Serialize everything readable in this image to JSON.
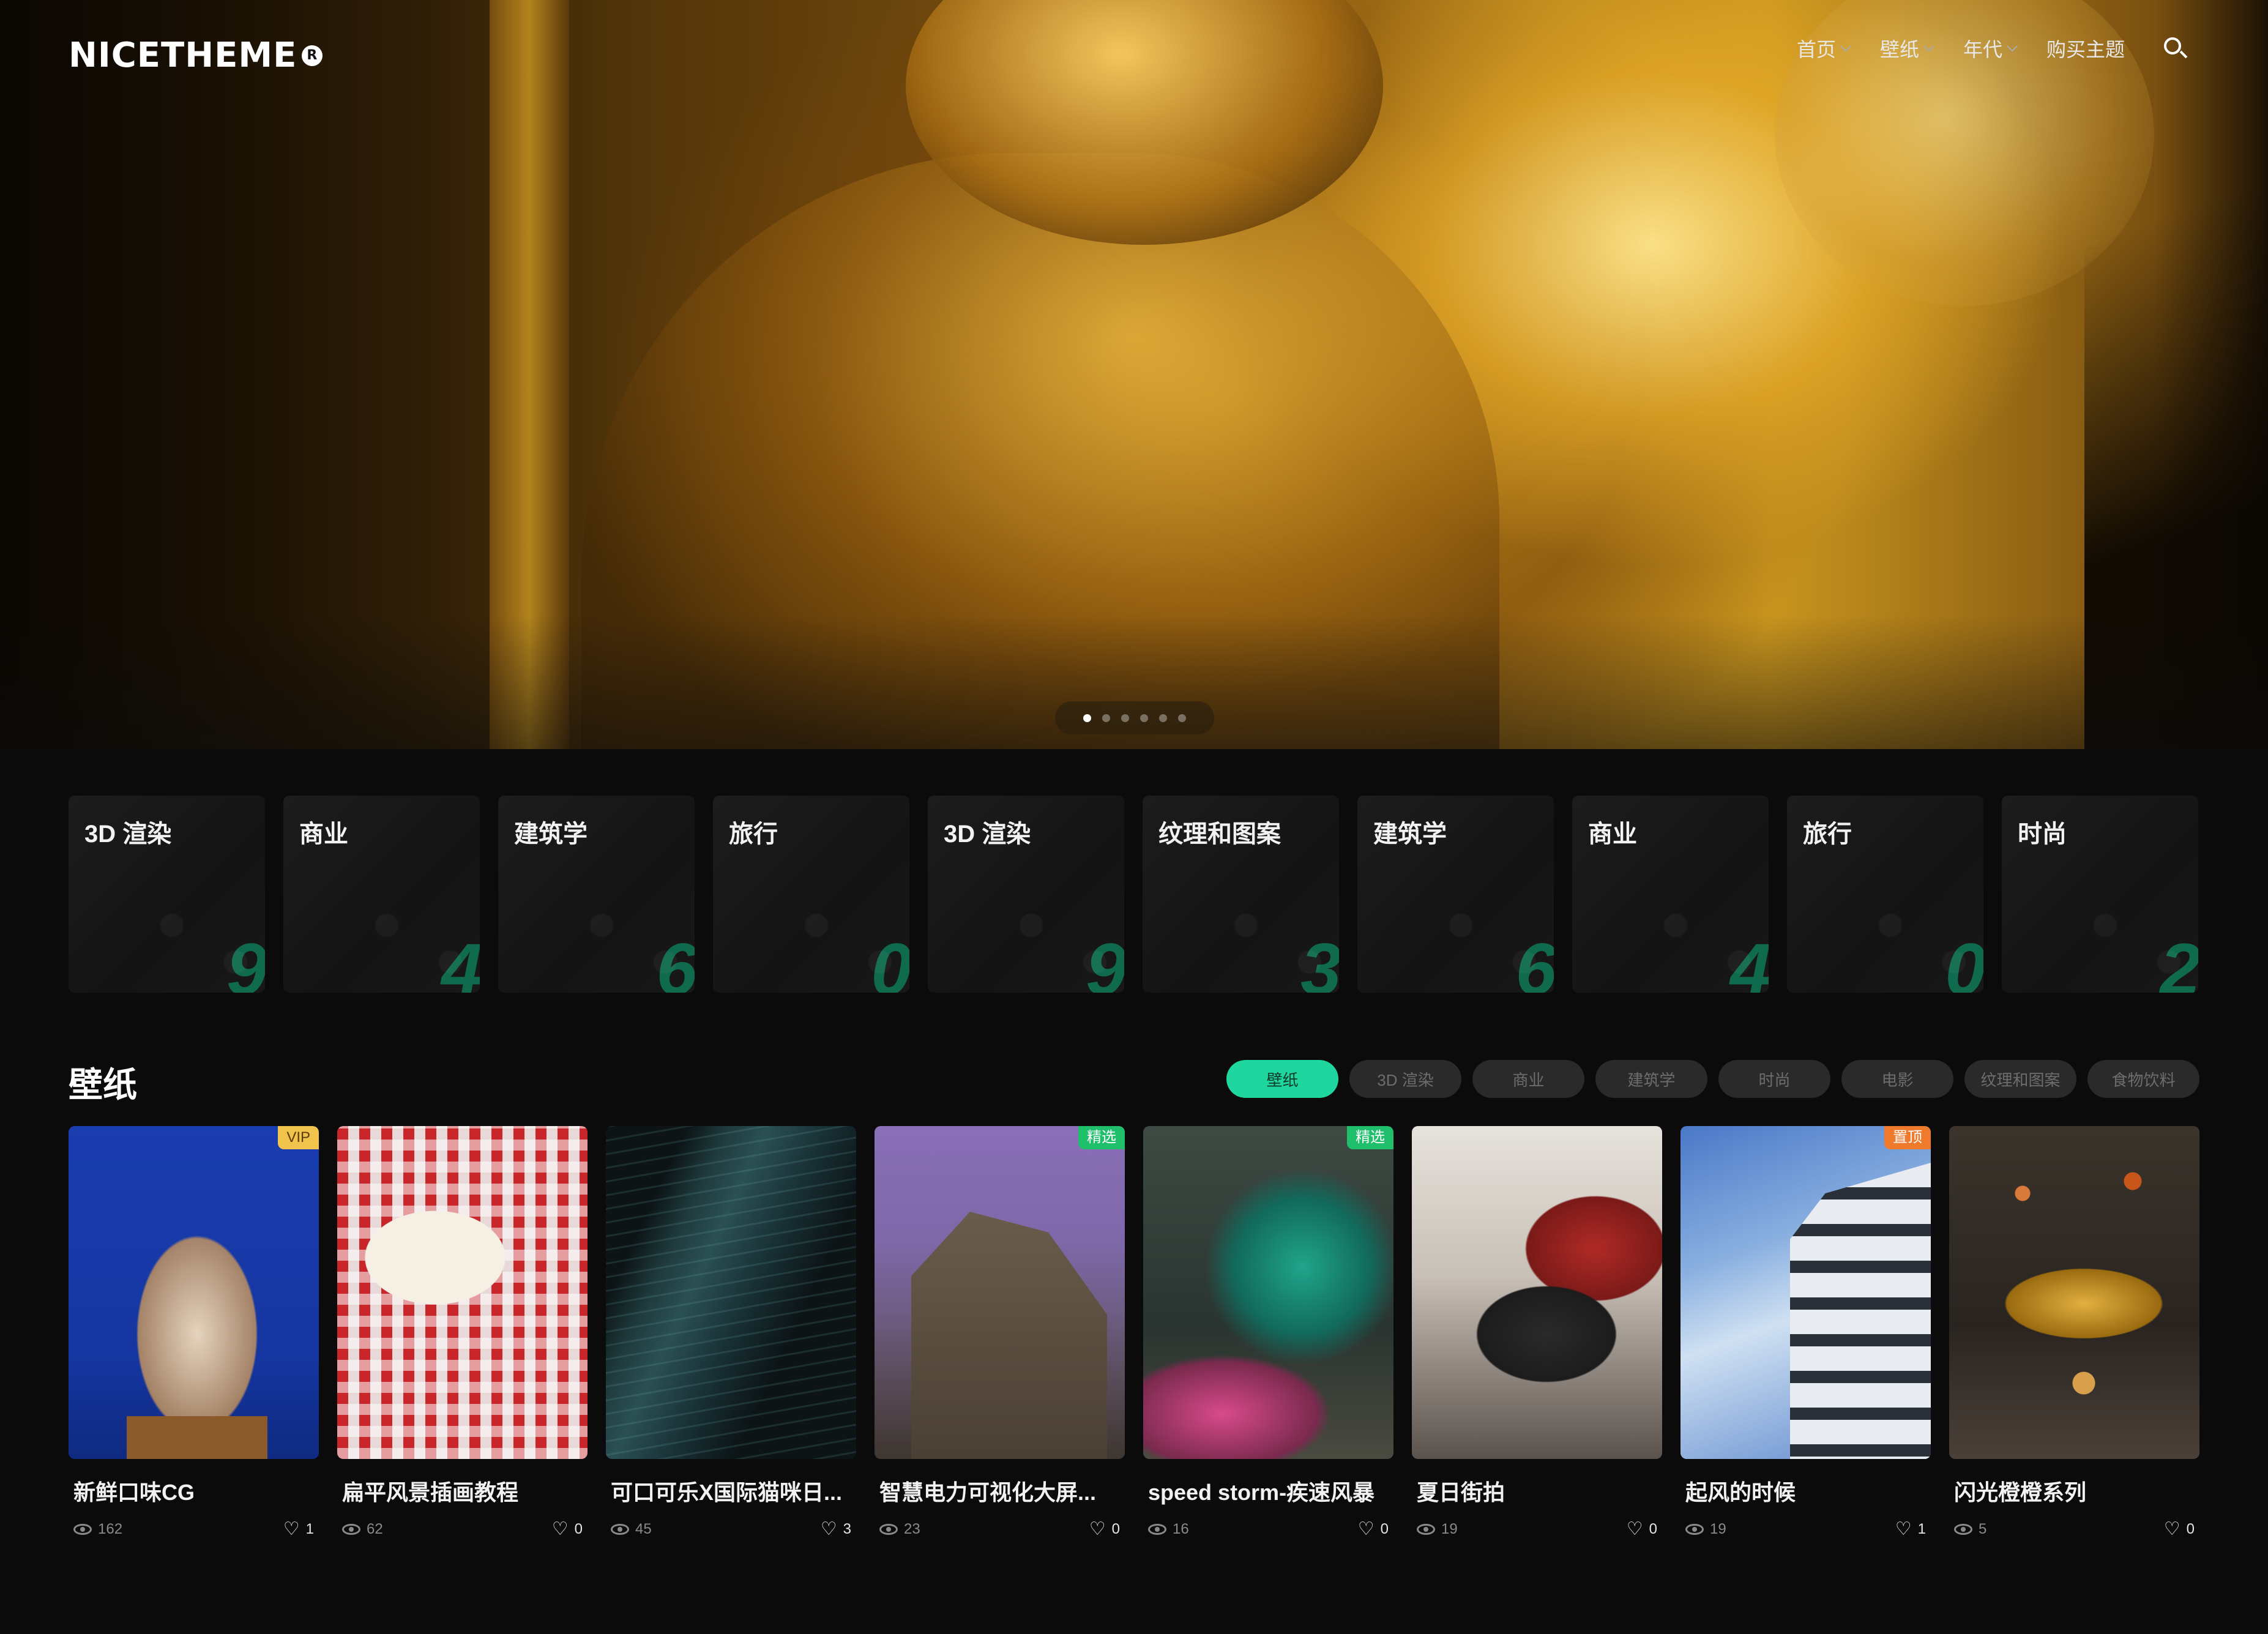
{
  "brand": {
    "logo_text": "NICETHEME",
    "logo_mark": "R"
  },
  "nav": {
    "items": [
      {
        "label": "首页",
        "has_dropdown": true
      },
      {
        "label": "壁纸",
        "has_dropdown": true
      },
      {
        "label": "年代",
        "has_dropdown": true
      },
      {
        "label": "购买主题",
        "has_dropdown": false
      }
    ],
    "search_icon": "search-icon"
  },
  "hero": {
    "slide_count": 6,
    "active_slide": 1
  },
  "categories": [
    {
      "label": "3D 渲染",
      "count": "9"
    },
    {
      "label": "商业",
      "count": "4"
    },
    {
      "label": "建筑学",
      "count": "6"
    },
    {
      "label": "旅行",
      "count": "0"
    },
    {
      "label": "3D 渲染",
      "count": "9"
    },
    {
      "label": "纹理和图案",
      "count": "3"
    },
    {
      "label": "建筑学",
      "count": "6"
    },
    {
      "label": "商业",
      "count": "4"
    },
    {
      "label": "旅行",
      "count": "0"
    },
    {
      "label": "时尚",
      "count": "2"
    }
  ],
  "section": {
    "title": "壁纸",
    "filters": [
      "壁纸",
      "3D 渲染",
      "商业",
      "建筑学",
      "时尚",
      "电影",
      "纹理和图案",
      "食物饮料"
    ],
    "active_filter": "壁纸"
  },
  "posts": [
    {
      "title": "新鲜口味CG",
      "views": "162",
      "likes": "1",
      "badge": "VIP"
    },
    {
      "title": "扁平风景插画教程",
      "views": "62",
      "likes": "0",
      "badge": ""
    },
    {
      "title": "可口可乐X国际猫咪日...",
      "views": "45",
      "likes": "3",
      "badge": ""
    },
    {
      "title": "智慧电力可视化大屏...",
      "views": "23",
      "likes": "0",
      "badge": "精选"
    },
    {
      "title": "speed storm-疾速风暴",
      "views": "16",
      "likes": "0",
      "badge": "精选"
    },
    {
      "title": "夏日街拍",
      "views": "19",
      "likes": "0",
      "badge": ""
    },
    {
      "title": "起风的时候",
      "views": "19",
      "likes": "1",
      "badge": "置顶"
    },
    {
      "title": "闪光橙橙系列",
      "views": "5",
      "likes": "0",
      "badge": ""
    }
  ],
  "colors": {
    "accent": "#1fd69e",
    "count_green": "#0f6a4e",
    "background": "#0b0b0b",
    "vip": "#f0c44c",
    "featured": "#1fbf6c",
    "pinned": "#f07a2c"
  }
}
